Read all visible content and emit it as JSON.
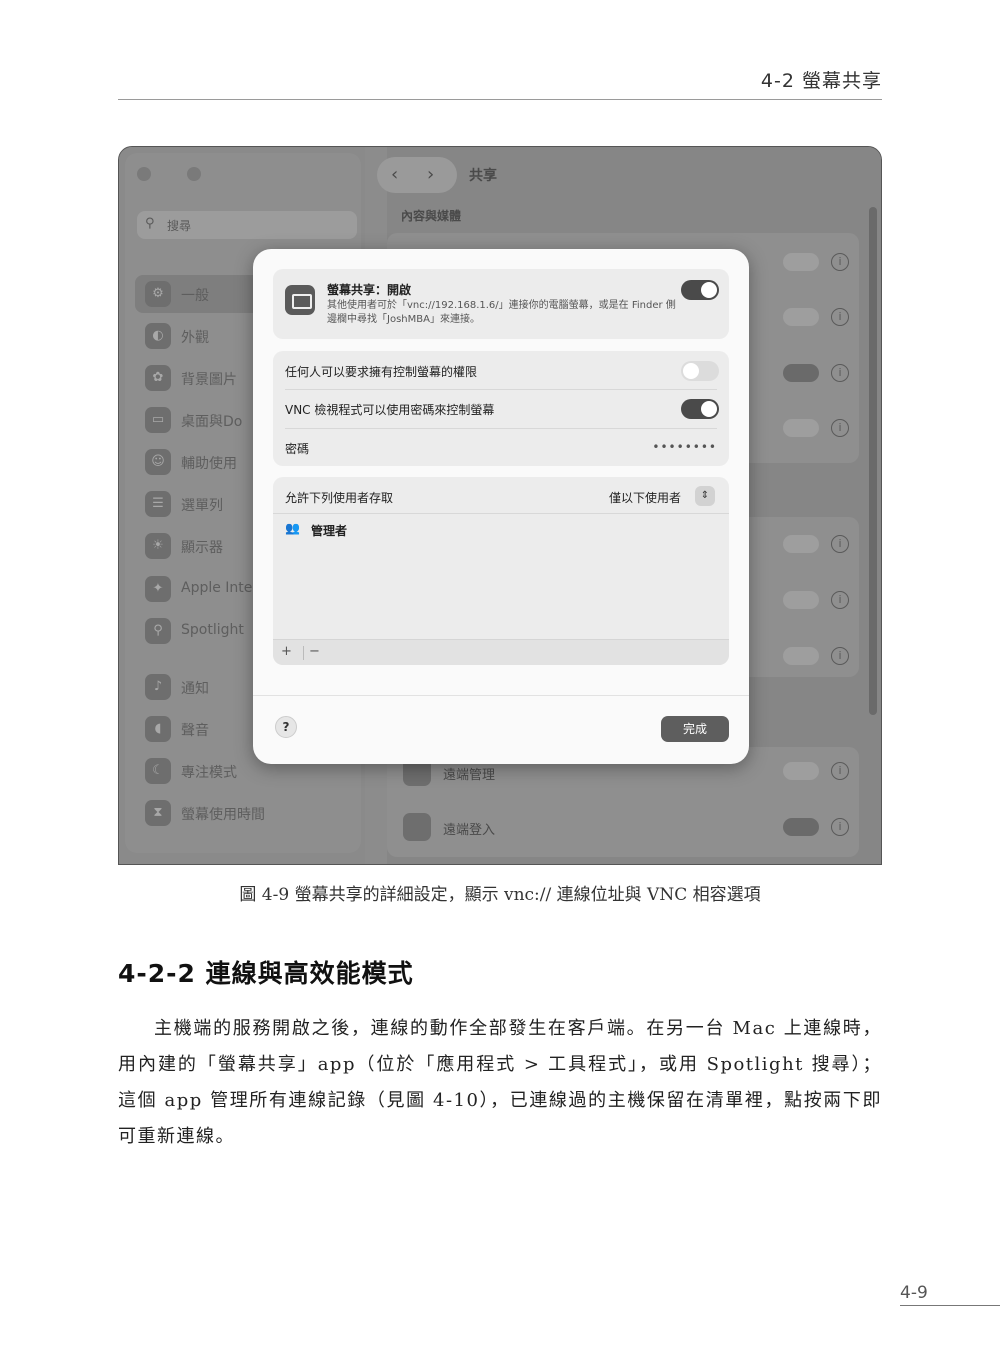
{
  "running_header": "4-2 螢幕共享",
  "figure": {
    "sidebar": {
      "search_placeholder": "搜尋",
      "items": [
        {
          "label": "一般",
          "icon": "gear-icon"
        },
        {
          "label": "外觀",
          "icon": "appearance-icon"
        },
        {
          "label": "背景圖片",
          "icon": "wallpaper-icon"
        },
        {
          "label": "桌面與Do",
          "icon": "desktop-dock-icon"
        },
        {
          "label": "輔助使用",
          "icon": "accessibility-icon"
        },
        {
          "label": "選單列",
          "icon": "menubar-icon"
        },
        {
          "label": "顯示器",
          "icon": "display-icon"
        },
        {
          "label": "Apple Inte",
          "icon": "apple-intelligence-icon"
        },
        {
          "label": "Spotlight",
          "icon": "spotlight-icon"
        },
        {
          "label": "通知",
          "icon": "notification-icon"
        },
        {
          "label": "聲音",
          "icon": "sound-icon"
        },
        {
          "label": "專注模式",
          "icon": "focus-icon"
        },
        {
          "label": "螢幕使用時間",
          "icon": "screen-time-icon"
        }
      ]
    },
    "main": {
      "title": "共享",
      "section_label": "內容與媒體",
      "rows": [
        {
          "label": "遠端管理",
          "icon": "remote-management-icon"
        },
        {
          "label": "遠端登入",
          "icon": "remote-login-icon"
        }
      ]
    },
    "sheet": {
      "screen_sharing_title": "螢幕共享：開啟",
      "screen_sharing_desc": "其他使用者可於「vnc://192.168.1.6/」連接你的電腦螢幕，或是在 Finder 側邊欄中尋找「JoshMBA」來連接。",
      "anyone_request_label": "任何人可以要求擁有控制螢幕的權限",
      "vnc_label": "VNC 檢視程式可以使用密碼來控制螢幕",
      "password_label": "密碼",
      "password_value": "••••••••",
      "allow_access_label": "允許下列使用者存取",
      "allow_access_value": "僅以下使用者",
      "users": [
        {
          "name": "管理者",
          "icon": "group-icon"
        }
      ],
      "add_button": "+",
      "remove_button": "−",
      "help_button": "?",
      "done_button": "完成"
    }
  },
  "caption": "圖 4-9  螢幕共享的詳細設定，顯示 vnc:// 連線位址與 VNC 相容選項",
  "section_heading": "4-2-2  連線與高效能模式",
  "paragraph": "主機端的服務開啟之後，連線的動作全部發生在客戶端。在另一台 Mac 上連線時，用內建的「螢幕共享」app（位於「應用程式 > 工具程式」，或用 Spotlight 搜尋）；這個 app 管理所有連線記錄（見圖 4-10），已連線過的主機保留在清單裡，點按兩下即可重新連線。",
  "page_number": "4-9"
}
